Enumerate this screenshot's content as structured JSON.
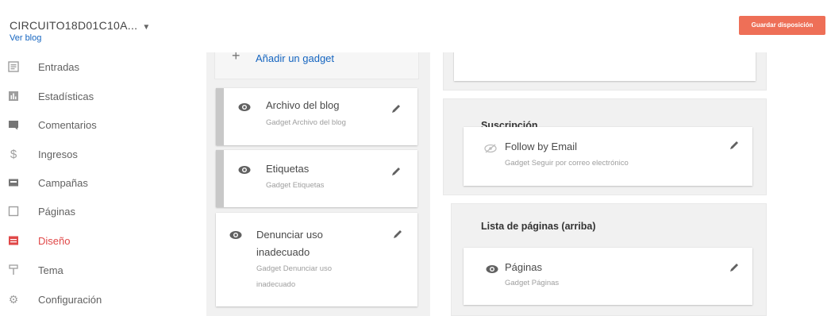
{
  "header": {
    "blog_title": "CIRCUITO18D01C10A...",
    "view_blog": "Ver blog",
    "save_button": "Guardar disposición"
  },
  "sidebar": {
    "items": [
      {
        "label": "Entradas",
        "icon": "posts-icon"
      },
      {
        "label": "Estadísticas",
        "icon": "stats-icon"
      },
      {
        "label": "Comentarios",
        "icon": "comments-icon"
      },
      {
        "label": "Ingresos",
        "icon": "dollar-icon"
      },
      {
        "label": "Campañas",
        "icon": "campaigns-icon"
      },
      {
        "label": "Páginas",
        "icon": "pages-icon"
      },
      {
        "label": "Diseño",
        "icon": "layout-icon",
        "active": true
      },
      {
        "label": "Tema",
        "icon": "theme-icon"
      },
      {
        "label": "Configuración",
        "icon": "settings-icon"
      }
    ]
  },
  "left_column": {
    "add_gadget": "Añadir un gadget",
    "gadgets": [
      {
        "title": "Archivo del blog",
        "subtitle": "Gadget Archivo del blog"
      },
      {
        "title": "Etiquetas",
        "subtitle": "Gadget Etiquetas"
      },
      {
        "title_line1": "Denunciar uso",
        "title_line2": "inadecuado",
        "subtitle_line1": "Gadget Denunciar uso",
        "subtitle_line2": "inadecuado"
      }
    ]
  },
  "right_column": {
    "sections": [
      {
        "title": "Suscripción",
        "gadget_title": "Follow by Email",
        "gadget_subtitle": "Gadget Seguir por correo electrónico",
        "visible": false
      },
      {
        "title": "Lista de páginas (arriba)",
        "gadget_title": "Páginas",
        "gadget_subtitle": "Gadget Páginas",
        "visible": true
      }
    ]
  },
  "colors": {
    "accent": "#ee6f57",
    "active_nav": "#e04848",
    "link": "#1565c0"
  }
}
